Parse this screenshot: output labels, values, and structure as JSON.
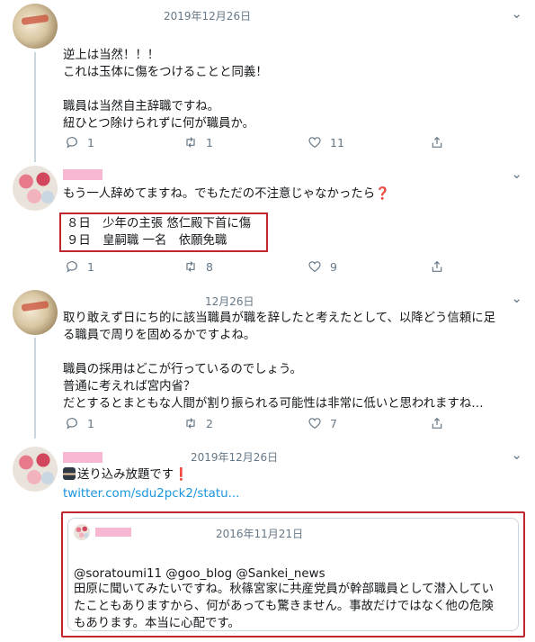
{
  "tweets": [
    {
      "date": "2019年12月26日",
      "lines": [
        "逆上は当然！！！",
        "これは玉体に傷をつけることと同義！",
        "",
        "職員は当然自主辞職ですね。",
        "紐ひとつ除けられずに何が職員か。"
      ],
      "reply_count": "1",
      "retweet_count": "1",
      "like_count": "11"
    },
    {
      "text": "もう一人辞めてますね。でもただの不注意じゃなかったら",
      "question_mark": "❓",
      "boxed_lines": [
        "８日　少年の主張 悠仁殿下首に傷",
        "９日　皇嗣職 一名　依願免職"
      ],
      "reply_count": "1",
      "retweet_count": "8",
      "like_count": "9"
    },
    {
      "date": "12月26日",
      "lines": [
        "取り敢えず日にち的に該当職員が職を辞したと考えたとして、以降どう信頼に足",
        "る職員で周りを固めるかですよね。",
        "",
        "職員の採用はどこが行っているのでしょう。",
        "普通に考えれば宮内省？",
        "だとするとまともな人間が割り振られる可能性は非常に低いと思われますね…"
      ],
      "reply_count": "1",
      "retweet_count": "2",
      "like_count": "7"
    },
    {
      "date": "2019年12月26日",
      "text": "送り込み放題です",
      "exclamation": "❗",
      "link": "twitter.com/sdu2pck2/statu...",
      "quote": {
        "date": "2016年11月21日",
        "lines": [
          "@soratoumi11 @goo_blog @Sankei_news",
          "田原に聞いてみたいですね。秋篠宮家に共産党員が幹部職員として潜入してい",
          "たこともありますから、何があっても驚きません。事故だけではなく他の危険",
          "もあります。本当に心配です。"
        ]
      }
    }
  ],
  "icons": {
    "reply": "reply-icon",
    "retweet": "retweet-icon",
    "like": "heart-icon",
    "share": "share-icon",
    "more": "chevron-down-icon"
  },
  "colors": {
    "highlight_box": "#c0272d",
    "redacted_name": "#f7b6d2",
    "link": "#1b95e0",
    "meta_text": "#657786"
  }
}
